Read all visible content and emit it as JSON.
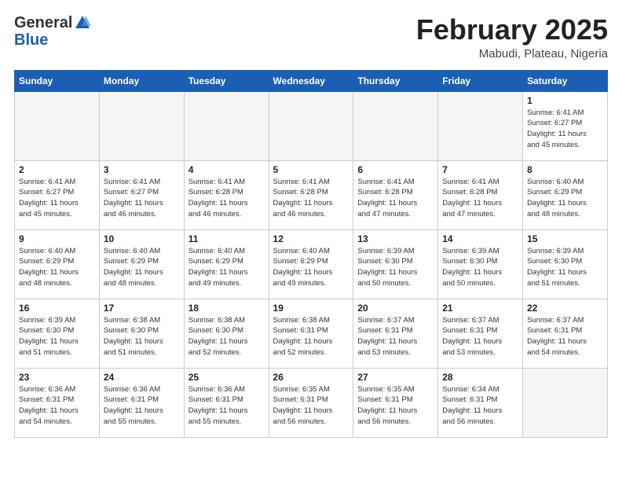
{
  "header": {
    "logo_general": "General",
    "logo_blue": "Blue",
    "month": "February 2025",
    "location": "Mabudi, Plateau, Nigeria"
  },
  "days_of_week": [
    "Sunday",
    "Monday",
    "Tuesday",
    "Wednesday",
    "Thursday",
    "Friday",
    "Saturday"
  ],
  "weeks": [
    [
      {
        "day": "",
        "info": ""
      },
      {
        "day": "",
        "info": ""
      },
      {
        "day": "",
        "info": ""
      },
      {
        "day": "",
        "info": ""
      },
      {
        "day": "",
        "info": ""
      },
      {
        "day": "",
        "info": ""
      },
      {
        "day": "1",
        "info": "Sunrise: 6:41 AM\nSunset: 6:27 PM\nDaylight: 11 hours\nand 45 minutes."
      }
    ],
    [
      {
        "day": "2",
        "info": "Sunrise: 6:41 AM\nSunset: 6:27 PM\nDaylight: 11 hours\nand 45 minutes."
      },
      {
        "day": "3",
        "info": "Sunrise: 6:41 AM\nSunset: 6:27 PM\nDaylight: 11 hours\nand 46 minutes."
      },
      {
        "day": "4",
        "info": "Sunrise: 6:41 AM\nSunset: 6:28 PM\nDaylight: 11 hours\nand 46 minutes."
      },
      {
        "day": "5",
        "info": "Sunrise: 6:41 AM\nSunset: 6:28 PM\nDaylight: 11 hours\nand 46 minutes."
      },
      {
        "day": "6",
        "info": "Sunrise: 6:41 AM\nSunset: 6:28 PM\nDaylight: 11 hours\nand 47 minutes."
      },
      {
        "day": "7",
        "info": "Sunrise: 6:41 AM\nSunset: 6:28 PM\nDaylight: 11 hours\nand 47 minutes."
      },
      {
        "day": "8",
        "info": "Sunrise: 6:40 AM\nSunset: 6:29 PM\nDaylight: 11 hours\nand 48 minutes."
      }
    ],
    [
      {
        "day": "9",
        "info": "Sunrise: 6:40 AM\nSunset: 6:29 PM\nDaylight: 11 hours\nand 48 minutes."
      },
      {
        "day": "10",
        "info": "Sunrise: 6:40 AM\nSunset: 6:29 PM\nDaylight: 11 hours\nand 48 minutes."
      },
      {
        "day": "11",
        "info": "Sunrise: 6:40 AM\nSunset: 6:29 PM\nDaylight: 11 hours\nand 49 minutes."
      },
      {
        "day": "12",
        "info": "Sunrise: 6:40 AM\nSunset: 6:29 PM\nDaylight: 11 hours\nand 49 minutes."
      },
      {
        "day": "13",
        "info": "Sunrise: 6:39 AM\nSunset: 6:30 PM\nDaylight: 11 hours\nand 50 minutes."
      },
      {
        "day": "14",
        "info": "Sunrise: 6:39 AM\nSunset: 6:30 PM\nDaylight: 11 hours\nand 50 minutes."
      },
      {
        "day": "15",
        "info": "Sunrise: 6:39 AM\nSunset: 6:30 PM\nDaylight: 11 hours\nand 51 minutes."
      }
    ],
    [
      {
        "day": "16",
        "info": "Sunrise: 6:39 AM\nSunset: 6:30 PM\nDaylight: 11 hours\nand 51 minutes."
      },
      {
        "day": "17",
        "info": "Sunrise: 6:38 AM\nSunset: 6:30 PM\nDaylight: 11 hours\nand 51 minutes."
      },
      {
        "day": "18",
        "info": "Sunrise: 6:38 AM\nSunset: 6:30 PM\nDaylight: 11 hours\nand 52 minutes."
      },
      {
        "day": "19",
        "info": "Sunrise: 6:38 AM\nSunset: 6:31 PM\nDaylight: 11 hours\nand 52 minutes."
      },
      {
        "day": "20",
        "info": "Sunrise: 6:37 AM\nSunset: 6:31 PM\nDaylight: 11 hours\nand 53 minutes."
      },
      {
        "day": "21",
        "info": "Sunrise: 6:37 AM\nSunset: 6:31 PM\nDaylight: 11 hours\nand 53 minutes."
      },
      {
        "day": "22",
        "info": "Sunrise: 6:37 AM\nSunset: 6:31 PM\nDaylight: 11 hours\nand 54 minutes."
      }
    ],
    [
      {
        "day": "23",
        "info": "Sunrise: 6:36 AM\nSunset: 6:31 PM\nDaylight: 11 hours\nand 54 minutes."
      },
      {
        "day": "24",
        "info": "Sunrise: 6:36 AM\nSunset: 6:31 PM\nDaylight: 11 hours\nand 55 minutes."
      },
      {
        "day": "25",
        "info": "Sunrise: 6:36 AM\nSunset: 6:31 PM\nDaylight: 11 hours\nand 55 minutes."
      },
      {
        "day": "26",
        "info": "Sunrise: 6:35 AM\nSunset: 6:31 PM\nDaylight: 11 hours\nand 56 minutes."
      },
      {
        "day": "27",
        "info": "Sunrise: 6:35 AM\nSunset: 6:31 PM\nDaylight: 11 hours\nand 56 minutes."
      },
      {
        "day": "28",
        "info": "Sunrise: 6:34 AM\nSunset: 6:31 PM\nDaylight: 11 hours\nand 56 minutes."
      },
      {
        "day": "",
        "info": ""
      }
    ]
  ]
}
